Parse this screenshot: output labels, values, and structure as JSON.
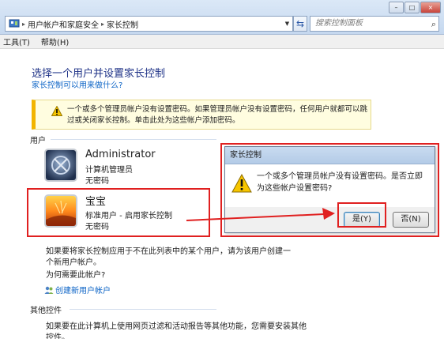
{
  "address_bar": {
    "breadcrumbs": [
      "用户帐户和家庭安全",
      "家长控制"
    ],
    "search_placeholder": "搜索控制面板"
  },
  "window_controls": {
    "minimize": "–",
    "maximize": "□",
    "close": "×"
  },
  "menu": {
    "items": [
      "工具(T)",
      "帮助(H)"
    ]
  },
  "main": {
    "heading": "选择一个用户并设置家长控制",
    "help_link": "家长控制可以用来做什么?",
    "warning": "一个或多个管理员帐户没有设置密码。如果管理员帐户没有设置密码，任何用户就都可以跳过或关闭家长控制。单击此处为这些帐户添加密码。",
    "users_label": "用户",
    "accounts": [
      {
        "name": "Administrator",
        "role": "计算机管理员",
        "password": "无密码"
      },
      {
        "name": "宝宝",
        "role": "标准用户 - 启用家长控制",
        "password": "无密码"
      }
    ],
    "info_text": "如果要将家长控制应用于不在此列表中的某个用户，请为该用户创建一个新用户帐户。",
    "why_link": "为何需要此帐户?",
    "create_link": "创建新用户帐户",
    "other_label": "其他控件",
    "other_text": "如果要在此计算机上使用网页过滤和活动报告等其他功能，您需要安装其他",
    "other_text_2": "控件。"
  },
  "dialog": {
    "title": "家长控制",
    "message": "一个或多个管理员帐户没有设置密码。是否立即为这些帐户设置密码?",
    "yes_button": "是(Y)",
    "no_button": "否(N)"
  },
  "colors": {
    "annotation_red": "#e02020",
    "link": "#0b63c6",
    "heading": "#1e3287",
    "warning_stripe": "#f2b400"
  }
}
